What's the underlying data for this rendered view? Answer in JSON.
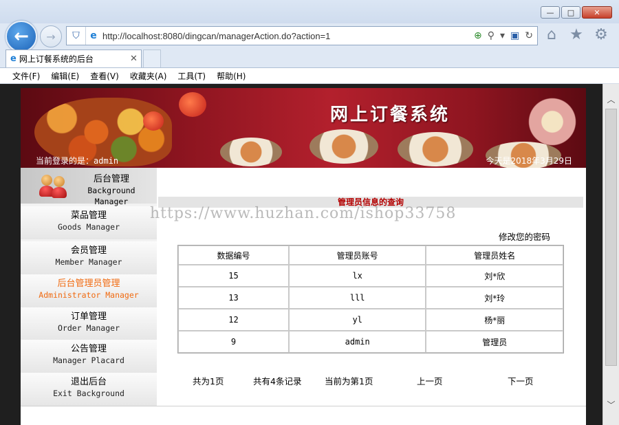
{
  "browser": {
    "url": "http://localhost:8080/dingcan/managerAction.do?action=1",
    "tab_title": "网上订餐系统的后台",
    "menu": [
      "文件(F)",
      "编辑(E)",
      "查看(V)",
      "收藏夹(A)",
      "工具(T)",
      "帮助(H)"
    ],
    "window_controls": [
      "minimize-icon",
      "maximize-icon",
      "close-icon"
    ],
    "nav_icons": [
      "home-icon",
      "favorites-star-icon",
      "settings-gear-icon"
    ]
  },
  "banner": {
    "title": "网上订餐系统",
    "login_text": "当前登录的是：admin",
    "date_text": "今天是2018年3月29日"
  },
  "sidebar": {
    "header": {
      "cn": "后台管理",
      "en": "Background Manager"
    },
    "items": [
      {
        "cn": "菜品管理",
        "en": "Goods Manager"
      },
      {
        "cn": "会员管理",
        "en": "Member Manager"
      },
      {
        "cn": "后台管理员管理",
        "en": "Administrator Manager"
      },
      {
        "cn": "订单管理",
        "en": "Order Manager"
      },
      {
        "cn": "公告管理",
        "en": "Manager Placard"
      },
      {
        "cn": "退出后台",
        "en": "Exit Background"
      }
    ],
    "active_color": "#f06a10"
  },
  "main": {
    "section_title": "管理员信息的查询",
    "watermark": "https://www.huzhan.com/ishop33758",
    "change_password": "修改您的密码",
    "table": {
      "headers": [
        "数据编号",
        "管理员账号",
        "管理员姓名"
      ],
      "rows": [
        [
          "15",
          "lx",
          "刘*欣"
        ],
        [
          "13",
          "lll",
          "刘*玲"
        ],
        [
          "12",
          "yl",
          "杨*丽"
        ],
        [
          "9",
          "admin",
          "管理员"
        ]
      ]
    },
    "pager": {
      "total_pages": "共为1页",
      "total_records": "共有4条记录",
      "current_page": "当前为第1页",
      "prev": "上一页",
      "next": "下一页"
    }
  }
}
